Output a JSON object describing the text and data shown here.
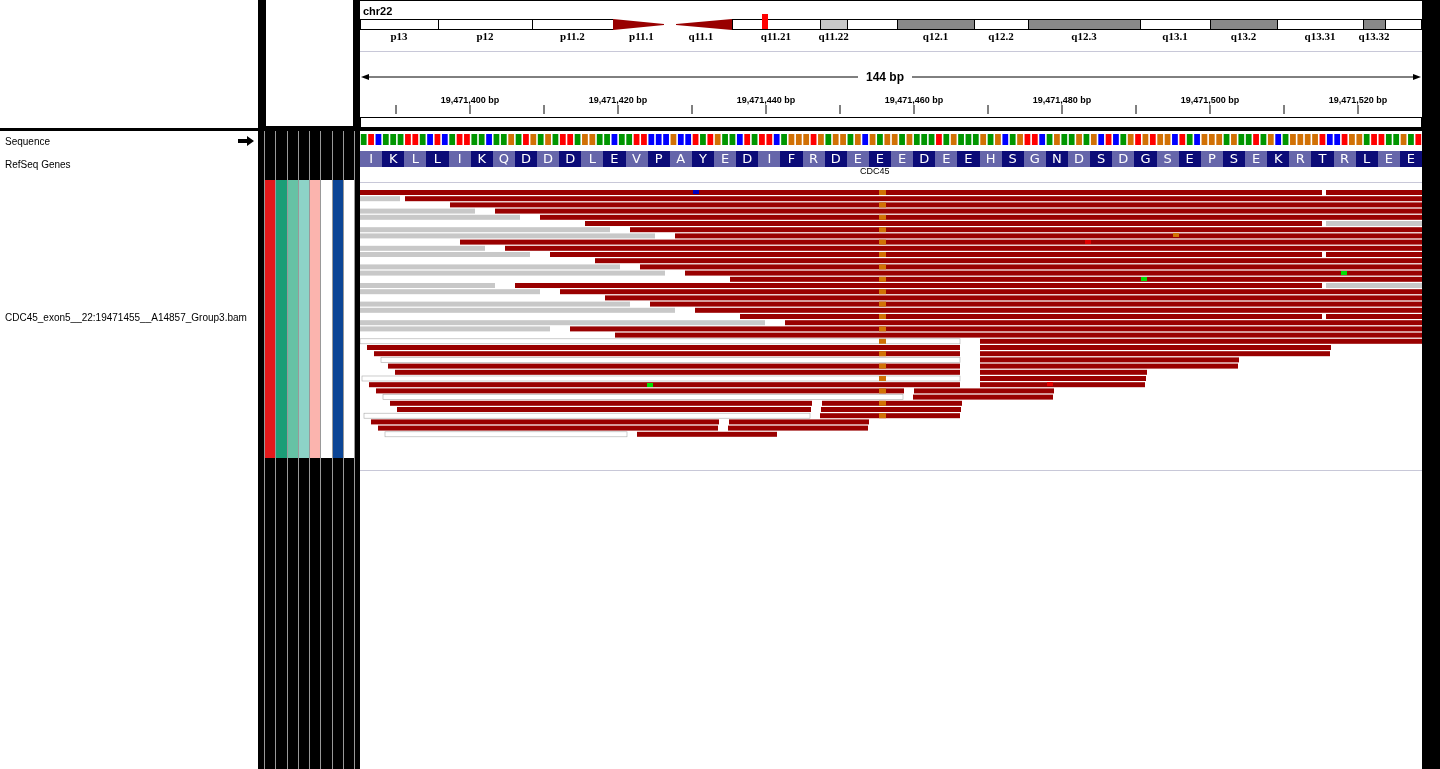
{
  "chromosome": {
    "name": "chr22",
    "bands": [
      {
        "label": "p13",
        "kind": "gneg"
      },
      {
        "label": "p12",
        "kind": "gneg"
      },
      {
        "label": "p11.2",
        "kind": "gneg"
      },
      {
        "label": "p11.1",
        "kind": "acenp"
      },
      {
        "label": "q11.1",
        "kind": "acenq"
      },
      {
        "label": "q11.21",
        "kind": "gneg"
      },
      {
        "label": "q11.22",
        "kind": "gpos25"
      },
      {
        "kind": "gneg"
      },
      {
        "label": "q12.1",
        "kind": "gpos50"
      },
      {
        "label": "q12.2",
        "kind": "gneg"
      },
      {
        "label": "q12.3",
        "kind": "gpos50"
      },
      {
        "label": "q13.1",
        "kind": "gneg"
      },
      {
        "label": "q13.2",
        "kind": "gpos50"
      },
      {
        "label": "q13.31",
        "kind": "gneg"
      },
      {
        "label": "q13.32",
        "kind": "gpos50"
      },
      {
        "kind": "gneg"
      }
    ]
  },
  "ruler": {
    "span": "144 bp",
    "ticks": [
      "19,471,400 bp",
      "19,471,420 bp",
      "19,471,440 bp",
      "19,471,460 bp",
      "19,471,480 bp",
      "19,471,500 bp",
      "19,471,520 bp"
    ]
  },
  "tracks": [
    {
      "name": "Sequence",
      "kind": "sequence"
    },
    {
      "name": "RefSeq Genes",
      "kind": "genes"
    },
    {
      "name": "CDC45_exon5__22:19471455__A14857_Group3.bam",
      "kind": "alignment"
    }
  ],
  "attributes": [
    {
      "color": "#e31a1c"
    },
    {
      "color": "#1b9e77"
    },
    {
      "color": "#66c2a5"
    },
    {
      "color": "#8dd3c7"
    },
    {
      "color": "#fbb4ae"
    },
    {
      "color": "#ffffff"
    },
    {
      "color": "#0b4596"
    },
    {
      "color": "#ffffff"
    }
  ],
  "translation": [
    "I",
    "K",
    "L",
    "L",
    "I",
    "K",
    "Q",
    "D",
    "D",
    "D",
    "L",
    "E",
    "V",
    "P",
    "A",
    "Y",
    "E",
    "D",
    "I",
    "F",
    "R",
    "D",
    "E",
    "E",
    "E",
    "D",
    "E",
    "E",
    "H",
    "S",
    "G",
    "N",
    "D",
    "S",
    "D",
    "G",
    "S",
    "E",
    "P",
    "S",
    "E",
    "K",
    "R",
    "T",
    "R",
    "L",
    "E",
    "E"
  ],
  "gene": {
    "name": "CDC45"
  }
}
